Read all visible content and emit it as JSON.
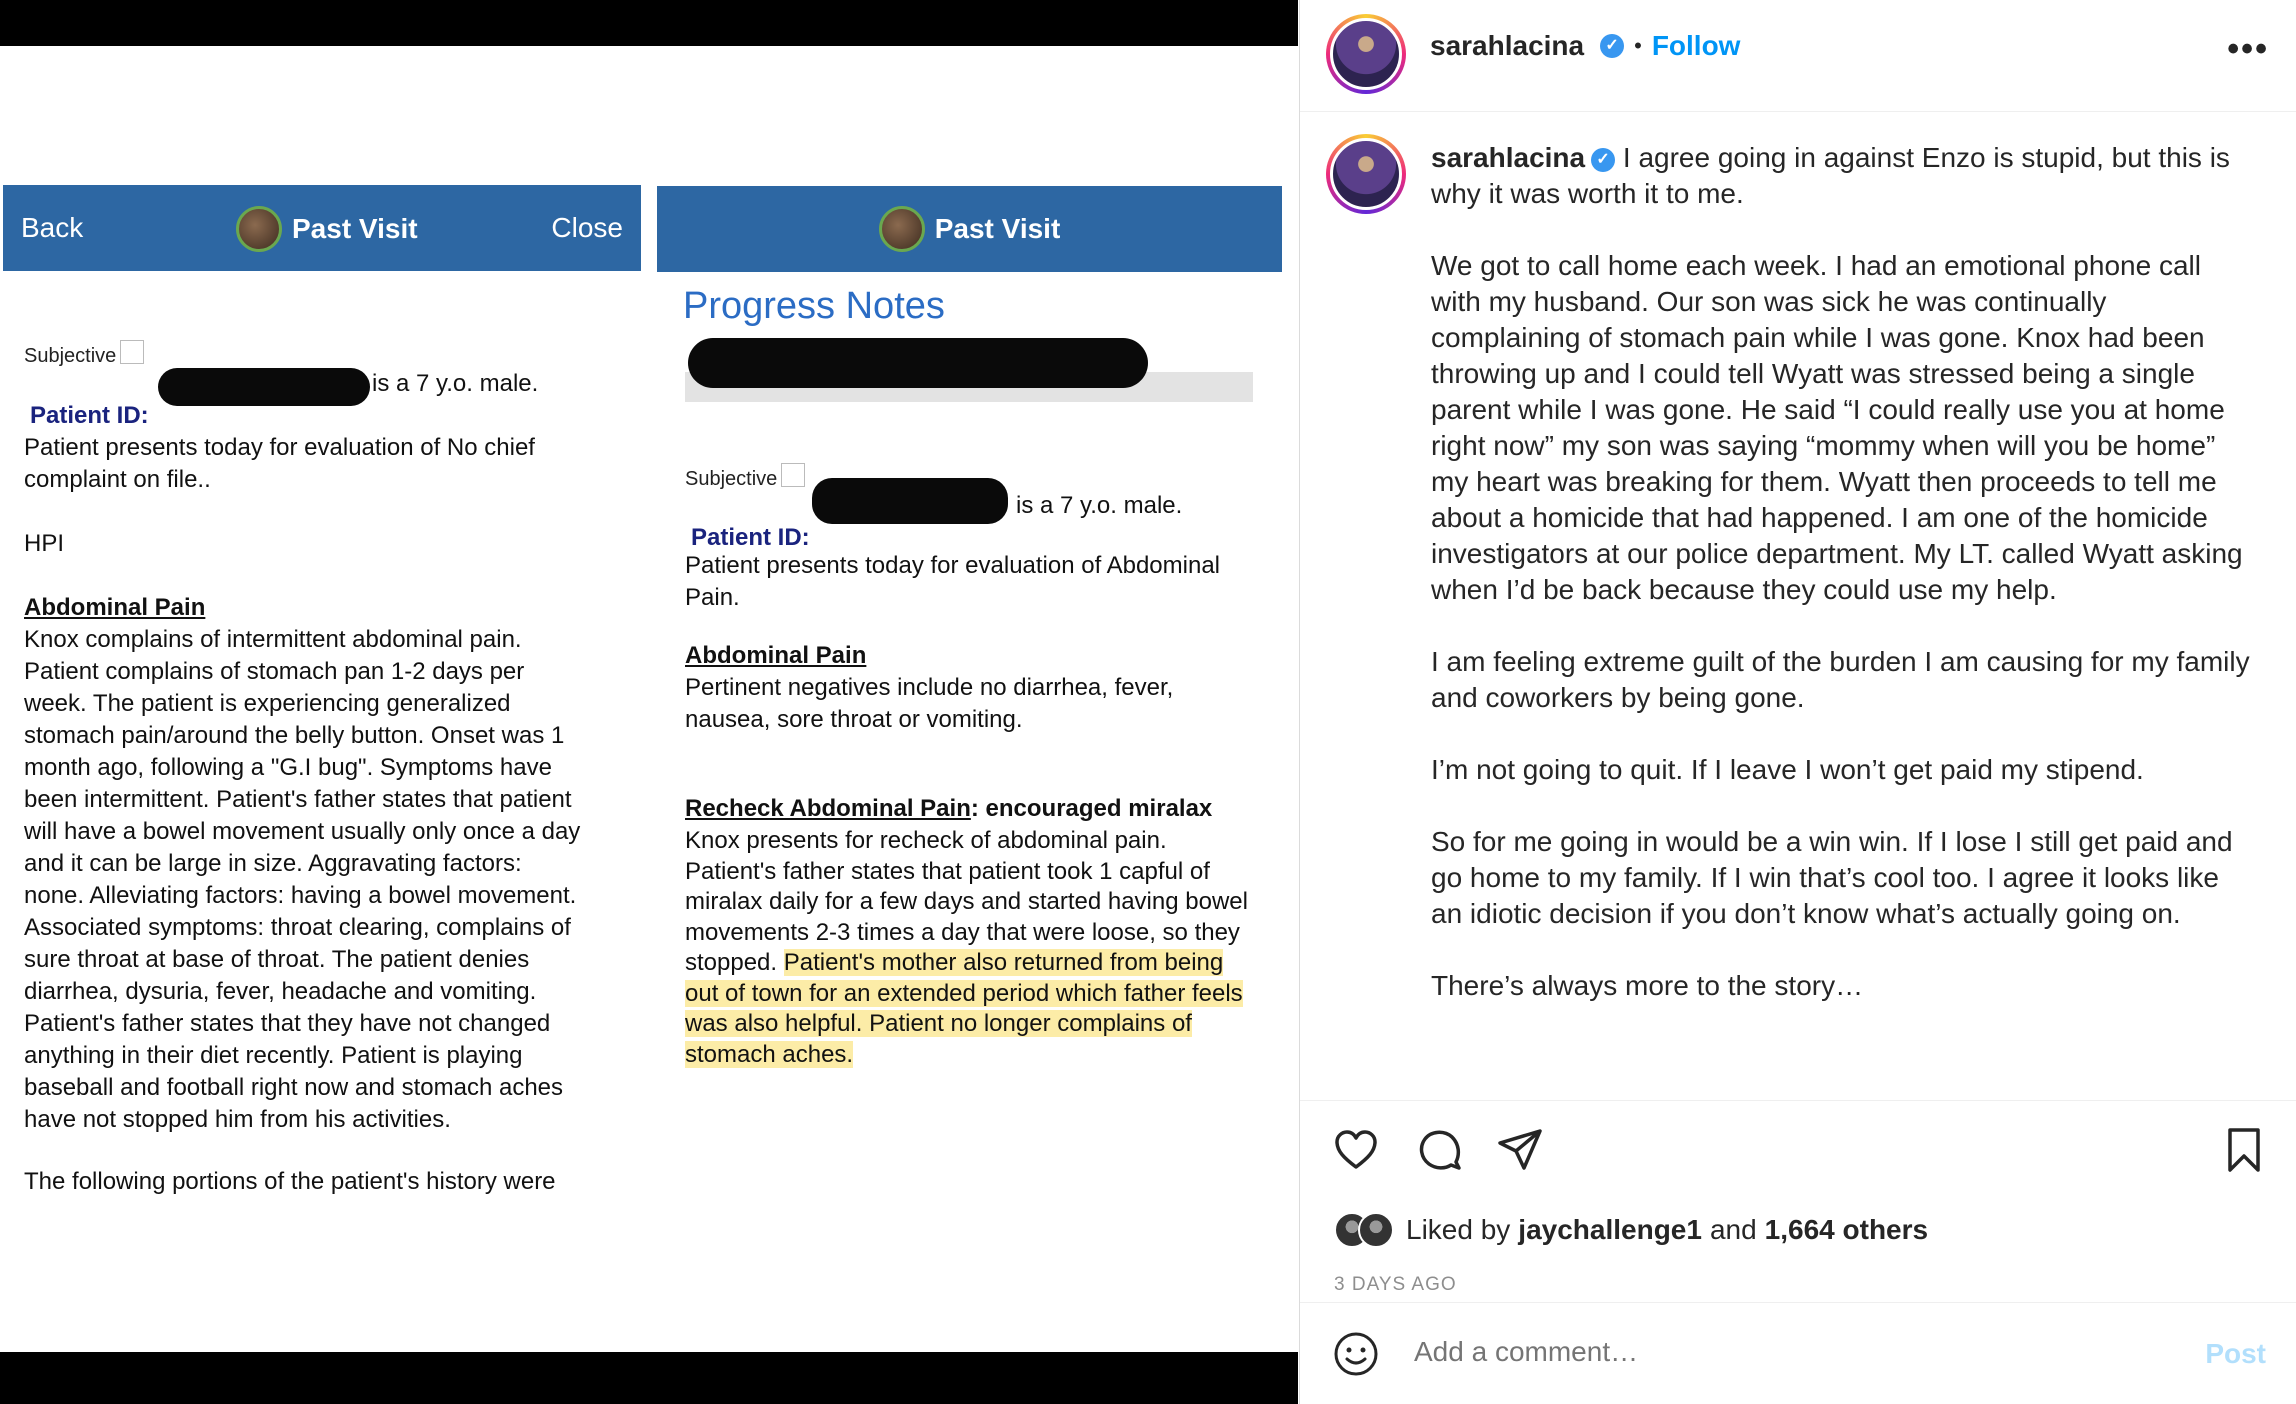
{
  "left_doc": {
    "header": {
      "back": "Back",
      "title": "Past Visit",
      "close": "Close"
    },
    "subjective_label": "Subjective",
    "patient_id_label": "Patient ID:",
    "patient_desc": "is a 7 y.o. male.",
    "presents": "Patient presents today for evaluation of No chief\ncomplaint on file..",
    "hpi": "HPI",
    "section_heading": "Abdominal Pain",
    "body": "Knox complains of intermittent abdominal pain.\nPatient complains of stomach pan 1-2 days per\nweek.  The patient is experiencing generalized\nstomach pain/around the belly button. Onset was 1\nmonth ago, following a \"G.I bug\". Symptoms have\nbeen intermittent. Patient's father states that patient\nwill have a bowel movement usually only once a day\nand it can be large in size.  Aggravating factors:\nnone.  Alleviating factors: having a bowel movement.\nAssociated symptoms: throat clearing, complains of\nsure throat at base of throat. The patient denies\ndiarrhea, dysuria, fever, headache and vomiting.\nPatient's father states that they have not changed\nanything in their diet recently.  Patient is playing\nbaseball and football right now and stomach aches\nhave not stopped him from his activities.",
    "following": "The following portions of the patient's history were"
  },
  "right_doc": {
    "header": {
      "title": "Past Visit"
    },
    "progress_notes": "Progress Notes",
    "subjective_label": "Subjective",
    "patient_id_label": "Patient ID:",
    "patient_desc": "is a 7 y.o. male.",
    "presents": "Patient presents today for evaluation of Abdominal\nPain.",
    "section_heading": "Abdominal Pain",
    "negatives": "Pertinent negatives include no diarrhea, fever,\nnausea, sore throat or vomiting.",
    "recheck_heading": "Recheck Abdominal Pain",
    "recheck_suffix": ": encouraged miralax",
    "recheck_body": "Knox presents for recheck of abdominal pain.\nPatient's father states that patient took 1 capful of\nmiralax daily for a few days and started having bowel\nmovements 2-3 times a day that were loose, so they\nstopped. ",
    "highlight_1": "Patient's mother also returned from being",
    "highlight_2": "out of town for an extended period which father feels",
    "highlight_3": "was also helpful.  Patient no longer complains of",
    "highlight_4": "stomach aches."
  },
  "post": {
    "username": "sarahlacina",
    "follow": "Follow",
    "dot": "•",
    "caption_user": "sarahlacina",
    "caption_first": "I agree going in against Enzo is stupid, but this is why it was worth it to me.",
    "paragraphs": [
      "We got to call home each week. I had an emotional phone call with my husband. Our son was sick he was continually complaining of stomach pain while I was gone. Knox had been throwing up and I could tell Wyatt was stressed being a single parent while I was gone. He said “I could really use you at home right now” my son was saying “mommy when will you be home” my heart was breaking for them. Wyatt then proceeds to tell me about a homicide that had happened. I am one of the homicide investigators at our police department. My LT. called Wyatt asking when I’d be back because they could use my help.",
      "I am feeling extreme guilt of the burden I am causing for my family and coworkers by being gone.",
      "I’m not going to quit. If I leave I won’t get paid my stipend.",
      "So for me going in would be a win win. If I lose I still get paid and go home to my family. If I win that’s cool too. I agree it looks like an idiotic decision if you don’t know what’s actually going on.",
      "There’s always more to the story…"
    ],
    "liked_prefix": "Liked by",
    "liked_user": "jaychallenge1",
    "liked_and": "and",
    "liked_others": "1,664 others",
    "timestamp": "3 DAYS AGO",
    "comment_placeholder": "Add a comment…",
    "post_button": "Post"
  },
  "colors": {
    "header_blue": "#2d67a3",
    "ig_blue": "#0095f6",
    "highlight": "#fae278"
  }
}
